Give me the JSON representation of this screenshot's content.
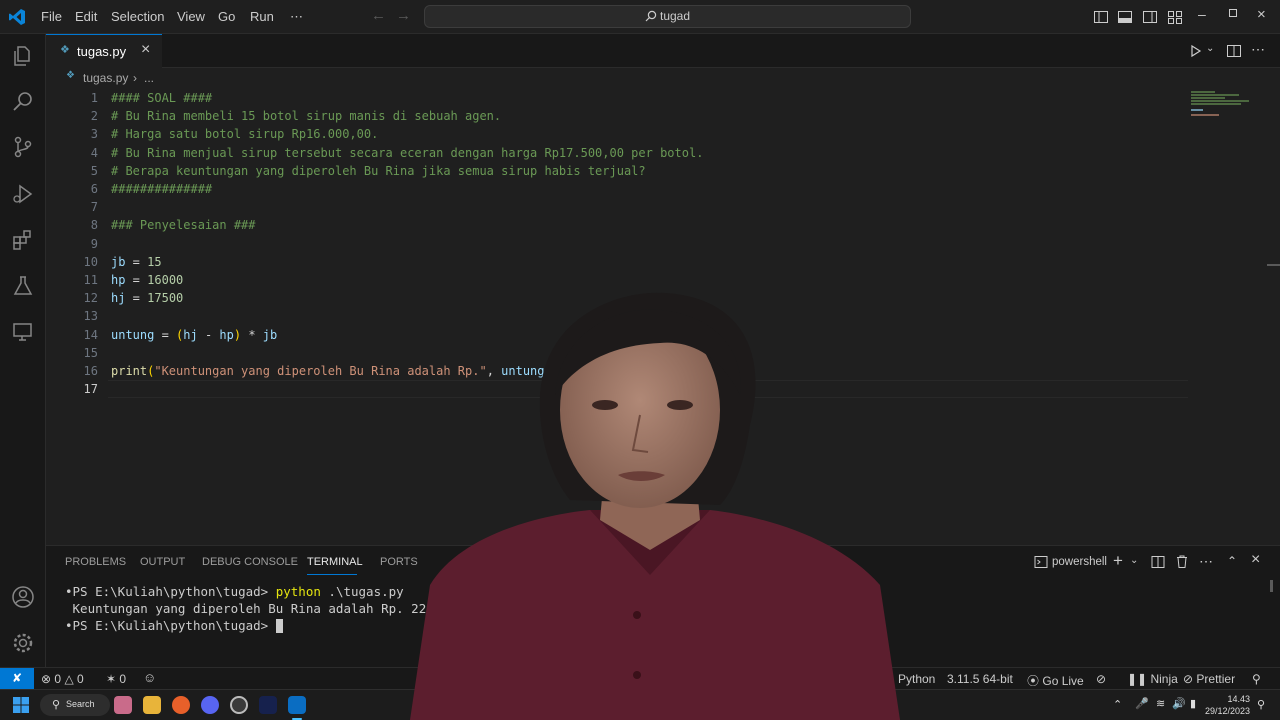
{
  "titlebar": {
    "menu": [
      "File",
      "Edit",
      "Selection",
      "View",
      "Go",
      "Run",
      "⋯"
    ],
    "command_center": "tugad"
  },
  "tab": {
    "label": "tugas.py",
    "close": "×"
  },
  "breadcrumb": {
    "file": "tugas.py",
    "more": "..."
  },
  "editor": {
    "lines": [
      {
        "n": "1",
        "parts": [
          [
            "cm",
            "#### SOAL ####"
          ]
        ]
      },
      {
        "n": "2",
        "parts": [
          [
            "cm",
            "# Bu Rina membeli 15 botol sirup manis di sebuah agen."
          ]
        ]
      },
      {
        "n": "3",
        "parts": [
          [
            "cm",
            "# Harga satu botol sirup Rp16.000,00."
          ]
        ]
      },
      {
        "n": "4",
        "parts": [
          [
            "cm",
            "# Bu Rina menjual sirup tersebut secara eceran dengan harga Rp17.500,00 per botol."
          ]
        ]
      },
      {
        "n": "5",
        "parts": [
          [
            "cm",
            "# Berapa keuntungan yang diperoleh Bu Rina jika semua sirup habis terjual?"
          ]
        ]
      },
      {
        "n": "6",
        "parts": [
          [
            "cm",
            "##############"
          ]
        ]
      },
      {
        "n": "7",
        "parts": []
      },
      {
        "n": "8",
        "parts": [
          [
            "cm",
            "### Penyelesaian ###"
          ]
        ]
      },
      {
        "n": "9",
        "parts": []
      },
      {
        "n": "10",
        "parts": [
          [
            "id",
            "jb"
          ],
          [
            "op",
            " = "
          ],
          [
            "num",
            "15"
          ]
        ]
      },
      {
        "n": "11",
        "parts": [
          [
            "id",
            "hp"
          ],
          [
            "op",
            " = "
          ],
          [
            "num",
            "16000"
          ]
        ]
      },
      {
        "n": "12",
        "parts": [
          [
            "id",
            "hj"
          ],
          [
            "op",
            " = "
          ],
          [
            "num",
            "17500"
          ]
        ]
      },
      {
        "n": "13",
        "parts": []
      },
      {
        "n": "14",
        "parts": [
          [
            "id",
            "untung"
          ],
          [
            "op",
            " = "
          ],
          [
            "par",
            "("
          ],
          [
            "id",
            "hj"
          ],
          [
            "op",
            " - "
          ],
          [
            "id",
            "hp"
          ],
          [
            "par",
            ")"
          ],
          [
            "op",
            " * "
          ],
          [
            "id",
            "jb"
          ]
        ]
      },
      {
        "n": "15",
        "parts": []
      },
      {
        "n": "16",
        "parts": [
          [
            "fn",
            "print"
          ],
          [
            "par",
            "("
          ],
          [
            "str",
            "\"Keuntungan yang diperoleh Bu Rina adalah Rp.\""
          ],
          [
            "op",
            ", "
          ],
          [
            "id",
            "untung"
          ]
        ]
      },
      {
        "n": "17",
        "parts": []
      }
    ]
  },
  "panel": {
    "tabs": [
      "PROBLEMS",
      "OUTPUT",
      "DEBUG CONSOLE",
      "TERMINAL",
      "PORTS"
    ],
    "active_tab": "TERMINAL",
    "shell": "powershell",
    "terminal": {
      "line1_prompt": "PS E:\\Kuliah\\python\\tugad> ",
      "line1_cmd": "python",
      "line1_arg": " .\\tugas.py",
      "line2": "Keuntungan yang diperoleh Bu Rina adalah Rp. 22500",
      "line3_prompt": "PS E:\\Kuliah\\python\\tugad> "
    }
  },
  "status": {
    "errors": "0",
    "warnings": "0",
    "ports": "0",
    "language": "Python",
    "version": "3.11.5 64-bit",
    "golive": "Go Live",
    "ninja": "Ninja",
    "prettier": "Prettier"
  },
  "taskbar": {
    "search": "Search",
    "time": "14.43",
    "date": "29/12/2023"
  },
  "colors": {
    "accent": "#0078d4",
    "comment": "#6a9955",
    "number": "#b5cea8",
    "string": "#ce9178"
  }
}
